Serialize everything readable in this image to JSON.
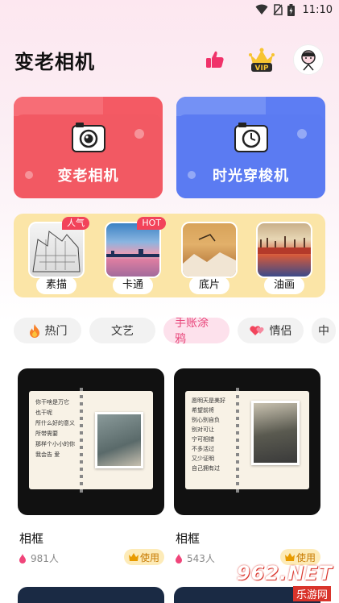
{
  "status_bar": {
    "time": "11:10"
  },
  "header": {
    "title": "变老相机"
  },
  "big_cards": [
    {
      "label": "变老相机"
    },
    {
      "label": "时光穿梭机"
    }
  ],
  "styles": [
    {
      "label": "素描",
      "badge": "人气"
    },
    {
      "label": "卡通",
      "badge": "HOT"
    },
    {
      "label": "底片",
      "badge": ""
    },
    {
      "label": "油画",
      "badge": ""
    }
  ],
  "categories": [
    {
      "label": "热门"
    },
    {
      "label": "文艺"
    },
    {
      "label": "手账涂鸦",
      "active": true
    },
    {
      "label": "情侣"
    }
  ],
  "tiles": [
    {
      "title": "相框",
      "count": "981人",
      "use_label": "使用",
      "scribble": [
        "你干啥是万它",
        "也干呢",
        "所什么好的意义",
        "所带需要",
        "那样个小小的你",
        "我会告 爱"
      ]
    },
    {
      "title": "相框",
      "count": "543人",
      "use_label": "使用",
      "scribble": [
        "愿明天是美好",
        "希望前将",
        "别心别自负",
        "别对可让",
        "宁可相错",
        "不多活过",
        "又少证明",
        "自己拥有过"
      ]
    }
  ],
  "watermark": {
    "main": "962.NET",
    "sub": "乐游网"
  },
  "colors": {
    "red_card": "#f45a64",
    "blue_card": "#5d7df3",
    "panel": "#fbe5a7",
    "accent_pink": "#e8457a"
  }
}
